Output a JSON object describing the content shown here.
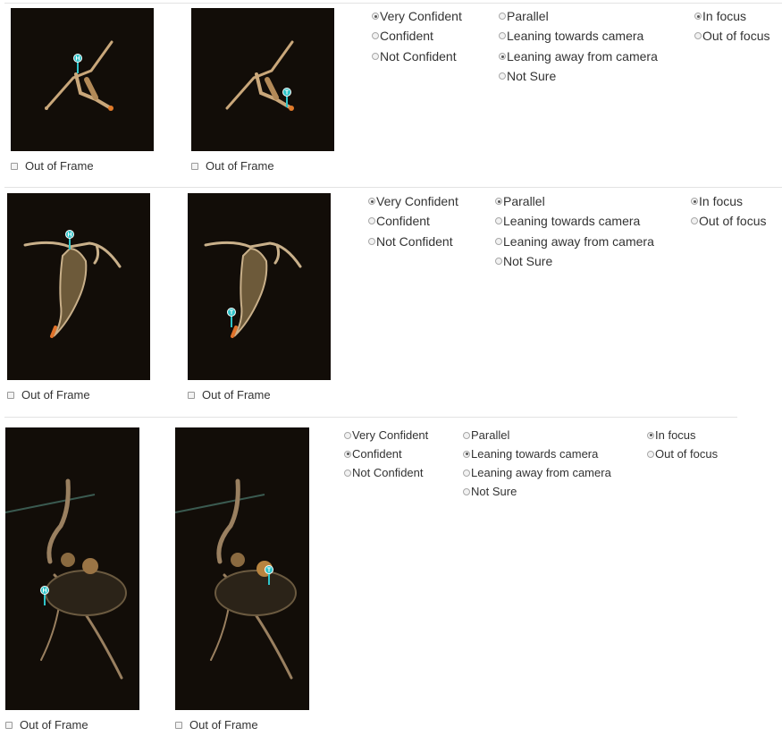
{
  "out_of_frame_label": "Out of Frame",
  "confidence_options": [
    "Very Confident",
    "Confident",
    "Not Confident"
  ],
  "orientation_options": [
    "Parallel",
    "Leaning towards camera",
    "Leaning away from camera",
    "Not Sure"
  ],
  "focus_options": [
    "In focus",
    "Out of focus"
  ],
  "markers": {
    "head": "H",
    "tail": "T"
  },
  "colors": {
    "marker": "#2ec4c9",
    "image_bg": "#120d08",
    "separator": "#e3e3e3"
  },
  "rows": [
    {
      "confidence_selected": "Very Confident",
      "orientation_selected": "Leaning away from camera",
      "focus_selected": "In focus",
      "out_of_frame_checked": [
        false,
        false
      ]
    },
    {
      "confidence_selected": "Very Confident",
      "orientation_selected": "Parallel",
      "focus_selected": "In focus",
      "out_of_frame_checked": [
        false,
        false
      ]
    },
    {
      "confidence_selected": "Confident",
      "orientation_selected": "Leaning towards camera",
      "focus_selected": "In focus",
      "out_of_frame_checked": [
        false,
        false
      ]
    }
  ]
}
